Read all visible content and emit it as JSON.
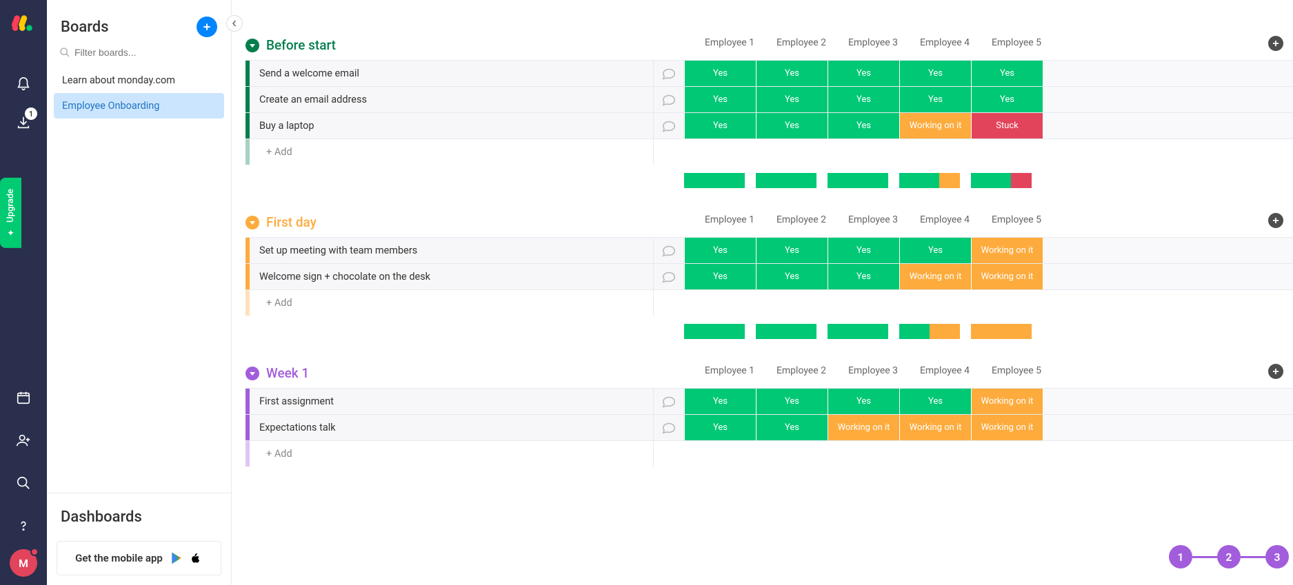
{
  "leftRail": {
    "notificationCount": "1",
    "upgradeLabel": "Upgrade",
    "avatarInitial": "M"
  },
  "sidebar": {
    "boardsTitle": "Boards",
    "filterPlaceholder": "Filter boards...",
    "items": [
      {
        "label": "Learn about monday.com",
        "active": false
      },
      {
        "label": "Employee Onboarding",
        "active": true
      }
    ],
    "dashboardsTitle": "Dashboards",
    "mobileCta": "Get the mobile app"
  },
  "columns": [
    "Employee 1",
    "Employee 2",
    "Employee 3",
    "Employee 4",
    "Employee 5"
  ],
  "statusLabels": {
    "yes": "Yes",
    "working": "Working on it",
    "stuck": "Stuck"
  },
  "addLabel": "+ Add",
  "groups": [
    {
      "name": "Before start",
      "color": "#037f4c",
      "tasks": [
        {
          "name": "Send a welcome email",
          "statuses": [
            "yes",
            "yes",
            "yes",
            "yes",
            "yes"
          ]
        },
        {
          "name": "Create an email address",
          "statuses": [
            "yes",
            "yes",
            "yes",
            "yes",
            "yes"
          ]
        },
        {
          "name": "Buy a laptop",
          "statuses": [
            "yes",
            "yes",
            "yes",
            "working",
            "stuck"
          ]
        }
      ],
      "footerBars": [
        [
          {
            "c": "#00c875",
            "p": 100
          }
        ],
        [
          {
            "c": "#00c875",
            "p": 100
          }
        ],
        [
          {
            "c": "#00c875",
            "p": 100
          }
        ],
        [
          {
            "c": "#00c875",
            "p": 66
          },
          {
            "c": "#fdab3d",
            "p": 34
          }
        ],
        [
          {
            "c": "#00c875",
            "p": 66
          },
          {
            "c": "#e2445c",
            "p": 34
          }
        ]
      ]
    },
    {
      "name": "First day",
      "color": "#fdab3d",
      "tasks": [
        {
          "name": "Set up meeting with team members",
          "statuses": [
            "yes",
            "yes",
            "yes",
            "yes",
            "working"
          ]
        },
        {
          "name": "Welcome sign + chocolate on the desk",
          "statuses": [
            "yes",
            "yes",
            "yes",
            "working",
            "working"
          ]
        }
      ],
      "footerBars": [
        [
          {
            "c": "#00c875",
            "p": 100
          }
        ],
        [
          {
            "c": "#00c875",
            "p": 100
          }
        ],
        [
          {
            "c": "#00c875",
            "p": 100
          }
        ],
        [
          {
            "c": "#00c875",
            "p": 50
          },
          {
            "c": "#fdab3d",
            "p": 50
          }
        ],
        [
          {
            "c": "#fdab3d",
            "p": 100
          }
        ]
      ]
    },
    {
      "name": "Week 1",
      "color": "#a25ddc",
      "tasks": [
        {
          "name": "First assignment",
          "statuses": [
            "yes",
            "yes",
            "yes",
            "yes",
            "working"
          ]
        },
        {
          "name": "Expectations talk",
          "statuses": [
            "yes",
            "yes",
            "working",
            "working",
            "working"
          ]
        }
      ],
      "footerBars": []
    }
  ],
  "onboardSteps": [
    "1",
    "2",
    "3"
  ]
}
